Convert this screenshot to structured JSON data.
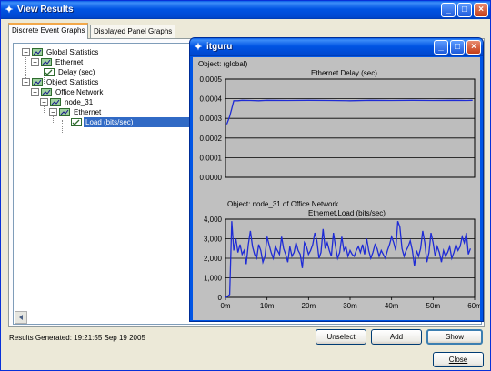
{
  "main_window": {
    "title": "View Results",
    "controls": [
      "_",
      "□",
      "×"
    ]
  },
  "tabs": [
    {
      "label": "Discrete Event Graphs",
      "active": true
    },
    {
      "label": "Displayed Panel Graphs",
      "active": false
    }
  ],
  "tree": {
    "global_statistics": "Global Statistics",
    "global_ethernet": "Ethernet",
    "delay": "Delay (sec)",
    "object_statistics": "Object Statistics",
    "office_network": "Office Network",
    "node_31": "node_31",
    "node_ethernet": "Ethernet",
    "load": "Load (bits/sec)"
  },
  "status": "Results Generated: 19:21:55 Sep 19 2005",
  "buttons": {
    "unselect": "Unselect",
    "add": "Add",
    "show": "Show",
    "close": "Close"
  },
  "graph_window": {
    "title": "itguru",
    "controls": [
      "_",
      "□",
      "×"
    ]
  },
  "chart_data": [
    {
      "type": "line",
      "object_label": "Object: (global)",
      "title": "Ethernet.Delay (sec)",
      "yticks": [
        "0.0005",
        "0.0004",
        "0.0003",
        "0.0002",
        "0.0001",
        "0.0000"
      ],
      "ylim": [
        0,
        0.0005
      ],
      "xlim": [
        0,
        60
      ],
      "series": [
        {
          "color": "#1E2BD6",
          "x": [
            0.3,
            1,
            1.5,
            2,
            3,
            4,
            6,
            8,
            10,
            15,
            20,
            25,
            30,
            35,
            40,
            45,
            50,
            55,
            58,
            59.5
          ],
          "y": [
            0.00027,
            0.00031,
            0.00035,
            0.00039,
            0.00039,
            0.000392,
            0.000391,
            0.00039,
            0.000392,
            0.000391,
            0.000392,
            0.000391,
            0.00039,
            0.000392,
            0.000391,
            0.000392,
            0.000391,
            0.000392,
            0.000391,
            0.000392
          ]
        }
      ]
    },
    {
      "type": "line",
      "object_label": "Object: node_31 of Office Network",
      "title": "Ethernet.Load (bits/sec)",
      "yticks": [
        "4,000",
        "3,000",
        "2,000",
        "1,000",
        "0"
      ],
      "ylim": [
        0,
        4000
      ],
      "xlim": [
        0,
        60
      ],
      "xticks": [
        "0m",
        "10m",
        "20m",
        "30m",
        "40m",
        "50m",
        "60m"
      ],
      "series": [
        {
          "color": "#1E2BD6",
          "x": [
            0.0,
            0.5,
            1.0,
            1.5,
            2.0,
            2.5,
            3.0,
            3.5,
            4.0,
            4.5,
            5.0,
            5.5,
            6.0,
            6.5,
            7.0,
            7.5,
            8.0,
            8.5,
            9.0,
            9.5,
            10.0,
            10.5,
            11.0,
            11.5,
            12.0,
            12.5,
            13.0,
            13.5,
            14.0,
            14.5,
            15.0,
            15.5,
            16.0,
            16.5,
            17.0,
            17.5,
            18.0,
            18.5,
            19.0,
            19.5,
            20.0,
            20.5,
            21.0,
            21.5,
            22.0,
            22.5,
            23.0,
            23.5,
            24.0,
            24.5,
            25.0,
            25.5,
            26.0,
            26.5,
            27.0,
            27.5,
            28.0,
            28.5,
            29.0,
            29.5,
            30.0,
            30.5,
            31.0,
            31.5,
            32.0,
            32.5,
            33.0,
            33.5,
            34.0,
            34.5,
            35.0,
            35.5,
            36.0,
            36.5,
            37.0,
            37.5,
            38.0,
            38.5,
            39.0,
            39.5,
            40.0,
            40.5,
            41.0,
            41.5,
            42.0,
            42.5,
            43.0,
            43.5,
            44.0,
            44.5,
            45.0,
            45.5,
            46.0,
            46.5,
            47.0,
            47.5,
            48.0,
            48.5,
            49.0,
            49.5,
            50.0,
            50.5,
            51.0,
            51.5,
            52.0,
            52.5,
            53.0,
            53.5,
            54.0,
            54.5,
            55.0,
            55.5,
            56.0,
            56.5,
            57.0,
            57.5,
            58.0,
            58.5,
            59.0
          ],
          "y": [
            0,
            50,
            150,
            3900,
            2400,
            3000,
            2300,
            2700,
            2200,
            2400,
            1700,
            2700,
            3400,
            2600,
            2200,
            2000,
            2700,
            2400,
            1800,
            2100,
            3100,
            2700,
            2300,
            2000,
            2600,
            2400,
            2200,
            3100,
            2500,
            2200,
            1800,
            2600,
            2100,
            2300,
            2800,
            2400,
            2200,
            1500,
            2800,
            2600,
            2200,
            2400,
            2700,
            3300,
            2900,
            2000,
            2300,
            3500,
            2500,
            2800,
            2400,
            2100,
            3300,
            2600,
            2000,
            2300,
            3100,
            2400,
            2600,
            2100,
            2400,
            2200,
            2100,
            2400,
            2600,
            2300,
            2700,
            2200,
            3000,
            2400,
            2000,
            2300,
            2700,
            2500,
            2100,
            2400,
            2200,
            2000,
            2400,
            2700,
            3100,
            2800,
            2400,
            3900,
            3600,
            2500,
            2100,
            2400,
            2600,
            2900,
            2400,
            1600,
            2400,
            2100,
            2500,
            3400,
            2800,
            1800,
            2300,
            3300,
            2800,
            2100,
            2600,
            2300,
            1800,
            2400,
            2100,
            2300,
            2600,
            2000,
            2300,
            2700,
            2400,
            2600,
            3100,
            2800,
            3300,
            2200,
            2500
          ]
        }
      ]
    }
  ]
}
